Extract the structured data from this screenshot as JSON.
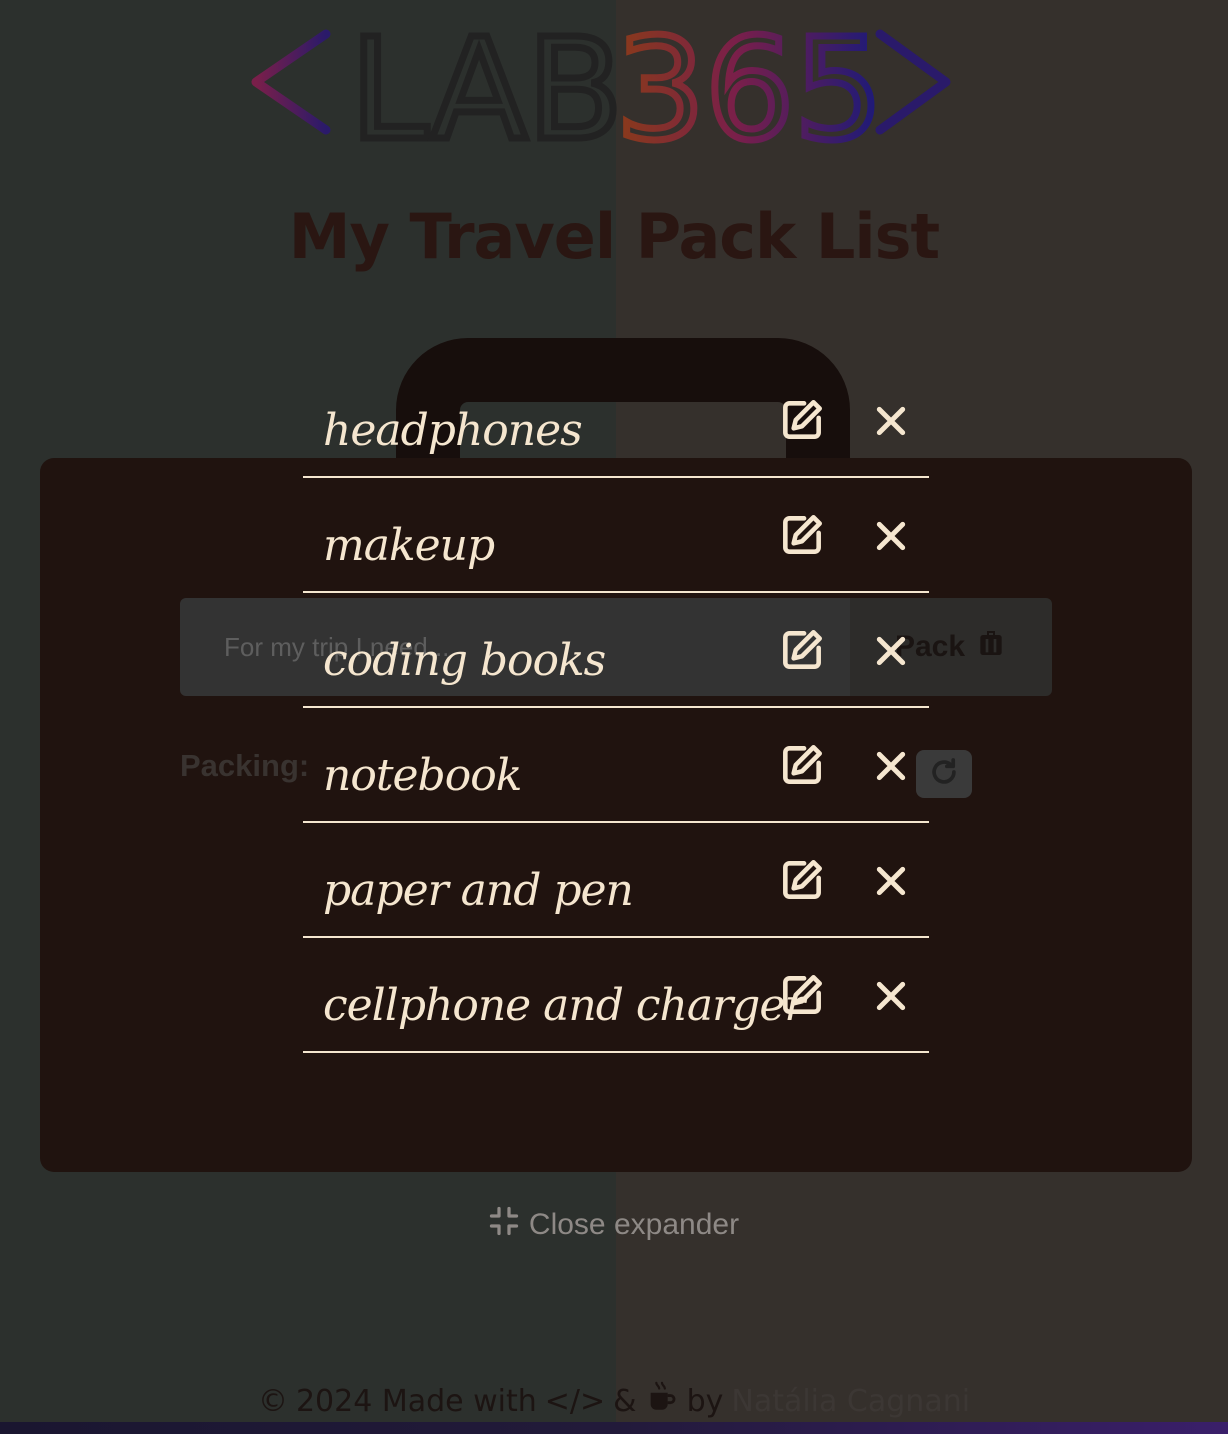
{
  "logo": {
    "text_left": "LAB",
    "text_right": "365"
  },
  "page_title": "My Travel Pack List",
  "form": {
    "input_placeholder": "For my trip I need...",
    "pack_label": "Pack"
  },
  "packing_label": "Packing:",
  "items": [
    {
      "label": "headphones"
    },
    {
      "label": "makeup"
    },
    {
      "label": "coding books"
    },
    {
      "label": "notebook"
    },
    {
      "label": "paper and pen"
    },
    {
      "label": "cellphone and charger"
    }
  ],
  "close_expander_label": "Close expander",
  "footer": {
    "copyright_symbol": "©",
    "year_text": "2024 Made with",
    "code_symbol": "</>",
    "amp": "&",
    "by": "by",
    "author": "Natália Cagnani"
  },
  "colors": {
    "background_left": "#2c302d",
    "background_right": "#35302c",
    "suitcase": "#20130f",
    "item_text": "#f5e6cf"
  },
  "icons": [
    "edit-icon",
    "close-icon",
    "suitcase-icon",
    "rotate-icon",
    "compress-icon",
    "coffee-icon",
    "copyright-icon"
  ]
}
